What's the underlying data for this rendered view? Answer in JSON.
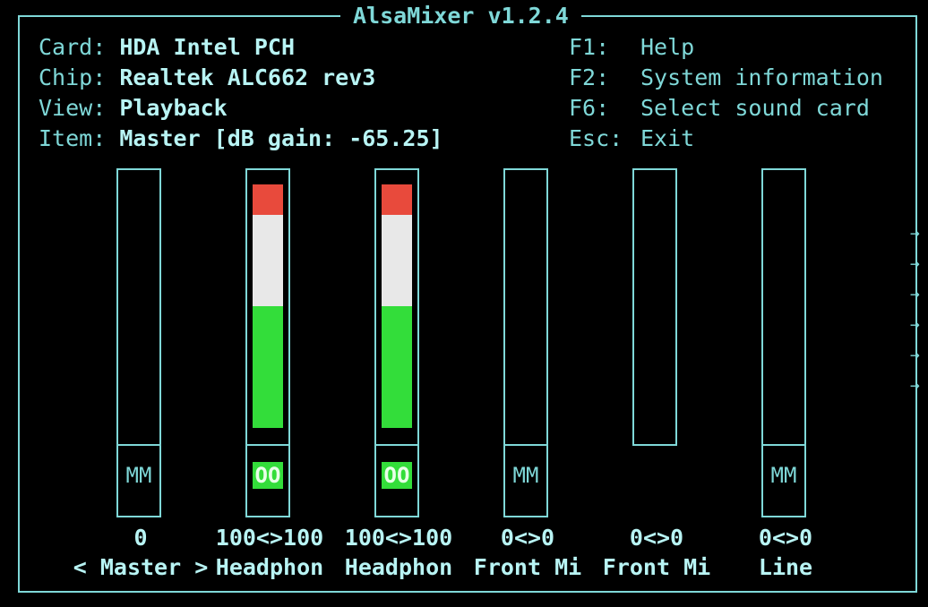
{
  "window": {
    "title": "AlsaMixer v1.2.4"
  },
  "info": {
    "card_label": "Card:",
    "card_value": "HDA Intel PCH",
    "chip_label": "Chip:",
    "chip_value": "Realtek ALC662 rev3",
    "view_label": "View:",
    "view_value": "Playback",
    "item_label": "Item:",
    "item_value": "Master [dB gain: -65.25]"
  },
  "keys": [
    {
      "key": "F1:",
      "desc": "Help"
    },
    {
      "key": "F2:",
      "desc": "System information"
    },
    {
      "key": "F6:",
      "desc": "Select sound card"
    },
    {
      "key": "Esc:",
      "desc": "Exit"
    }
  ],
  "controls": [
    {
      "name": "< Master >",
      "volume": "0",
      "switch": "MM",
      "switch_on": false,
      "level": 0,
      "has_switch": true
    },
    {
      "name": "Headphon",
      "volume": "100<>100",
      "switch": "OO",
      "switch_on": true,
      "level": 1.0,
      "has_switch": true
    },
    {
      "name": "Headphon",
      "volume": "100<>100",
      "switch": "OO",
      "switch_on": true,
      "level": 1.0,
      "has_switch": true
    },
    {
      "name": "Front Mi",
      "volume": "0<>0",
      "switch": "MM",
      "switch_on": false,
      "level": 0,
      "has_switch": true
    },
    {
      "name": "Front Mi",
      "volume": "0<>0",
      "switch": "",
      "switch_on": false,
      "level": 0,
      "has_switch": false
    },
    {
      "name": "Line",
      "volume": "0<>0",
      "switch": "MM",
      "switch_on": false,
      "level": 0,
      "has_switch": true
    }
  ],
  "scroll_arrows": [
    "→",
    "→",
    "→",
    "→",
    "→",
    "→"
  ],
  "colors": {
    "frame": "#7fd8d8",
    "level_low": "#33dd3a",
    "level_mid": "#e8e8e8",
    "level_high": "#e84a3c"
  }
}
